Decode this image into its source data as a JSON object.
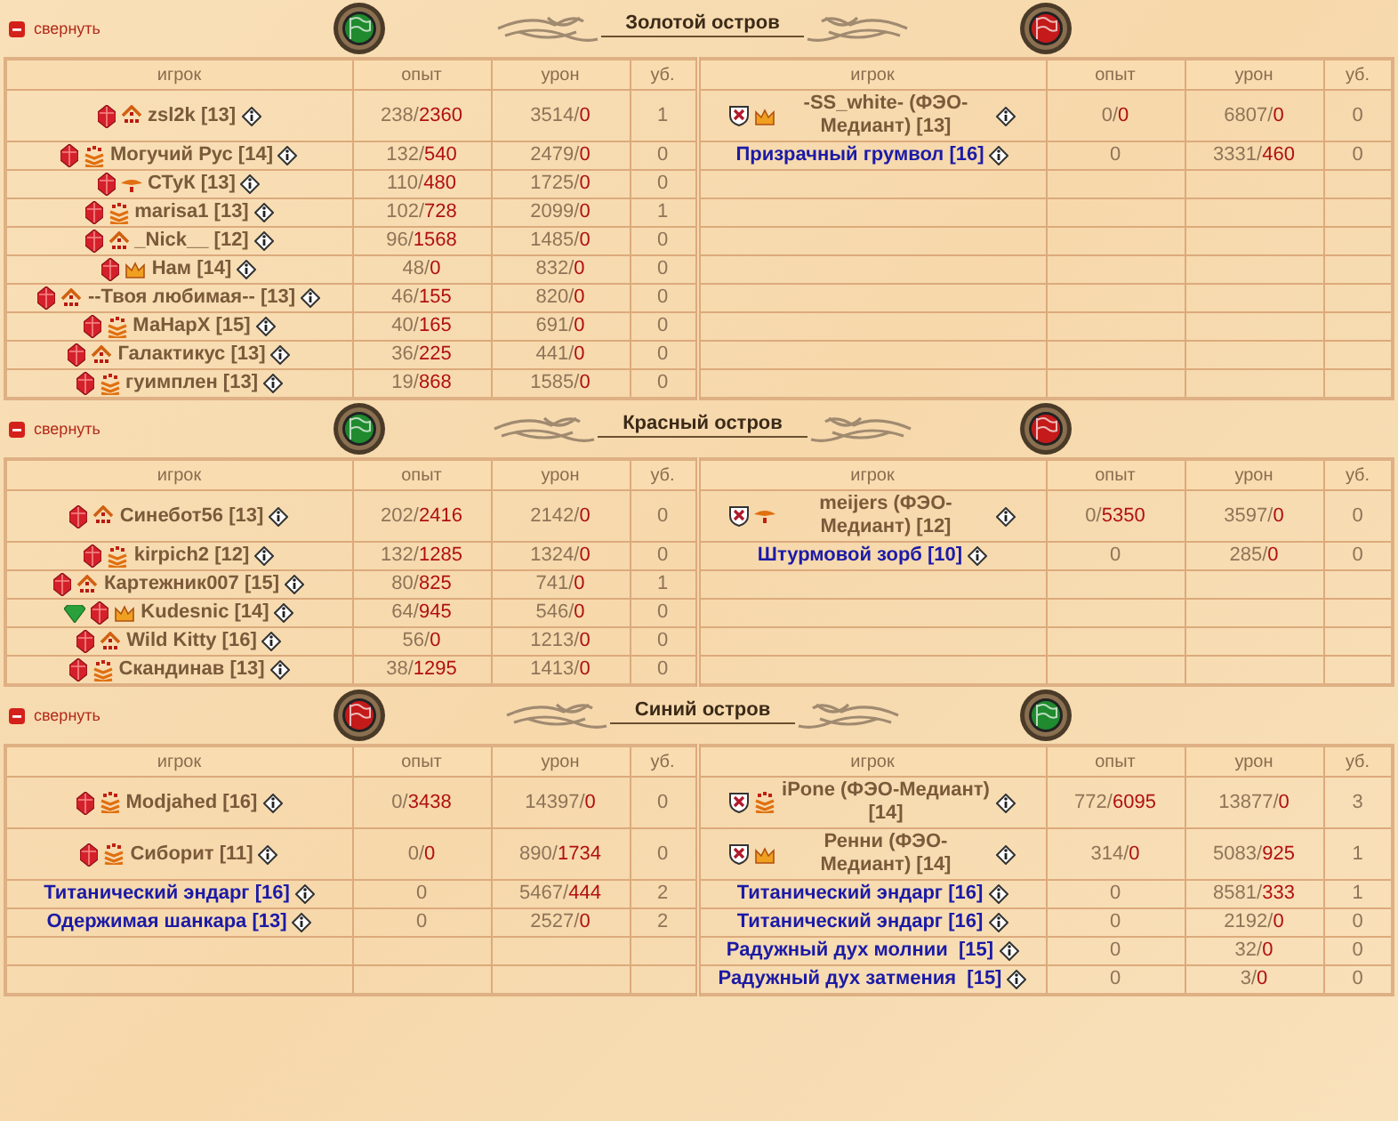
{
  "sections": [
    {
      "collapse": "свернуть",
      "title": "Золотой остров",
      "teams": [
        {
          "flag": {
            "color": "#1f8a2e"
          },
          "columns": [
            "игрок",
            "опыт",
            "урон",
            "уб."
          ],
          "players": [
            {
              "kind": "player",
              "icons": [
                {
                  "kind": "gem"
                },
                {
                  "kind": "pyramid"
                }
              ],
              "name": "zsl2k [13]",
              "exp": [
                "238/",
                "2360"
              ],
              "damage": [
                "3514/",
                "0"
              ],
              "kills": "1"
            },
            {
              "kind": "player",
              "icons": [
                {
                  "kind": "gem"
                },
                {
                  "kind": "stripes"
                }
              ],
              "name": "Могучий Рус [14]",
              "exp": [
                "132/",
                "540"
              ],
              "damage": [
                "2479/",
                "0"
              ],
              "kills": "0"
            },
            {
              "kind": "player",
              "icons": [
                {
                  "kind": "gem"
                },
                {
                  "kind": "wing"
                }
              ],
              "name": "СТуК [13]",
              "exp": [
                "110/",
                "480"
              ],
              "damage": [
                "1725/",
                "0"
              ],
              "kills": "0"
            },
            {
              "kind": "player",
              "icons": [
                {
                  "kind": "gem"
                },
                {
                  "kind": "stripes"
                }
              ],
              "name": "marisa1 [13]",
              "exp": [
                "102/",
                "728"
              ],
              "damage": [
                "2099/",
                "0"
              ],
              "kills": "1"
            },
            {
              "kind": "player",
              "icons": [
                {
                  "kind": "gem"
                },
                {
                  "kind": "pyramid"
                }
              ],
              "name": "_Nick__ [12]",
              "exp": [
                "96/",
                "1568"
              ],
              "damage": [
                "1485/",
                "0"
              ],
              "kills": "0"
            },
            {
              "kind": "player",
              "icons": [
                {
                  "kind": "gem"
                },
                {
                  "kind": "crown"
                }
              ],
              "name": "Нам [14]",
              "exp": [
                "48/",
                "0"
              ],
              "damage": [
                "832/",
                "0"
              ],
              "kills": "0"
            },
            {
              "kind": "player",
              "icons": [
                {
                  "kind": "gem"
                },
                {
                  "kind": "pyramid"
                }
              ],
              "name": "--Твоя любимая-- [13]",
              "exp": [
                "46/",
                "155"
              ],
              "damage": [
                "820/",
                "0"
              ],
              "kills": "0"
            },
            {
              "kind": "player",
              "icons": [
                {
                  "kind": "gem"
                },
                {
                  "kind": "stripes"
                }
              ],
              "name": "МаНарХ [15]",
              "exp": [
                "40/",
                "165"
              ],
              "damage": [
                "691/",
                "0"
              ],
              "kills": "0"
            },
            {
              "kind": "player",
              "icons": [
                {
                  "kind": "gem"
                },
                {
                  "kind": "pyramid"
                }
              ],
              "name": "Галактикус [13]",
              "exp": [
                "36/",
                "225"
              ],
              "damage": [
                "441/",
                "0"
              ],
              "kills": "0"
            },
            {
              "kind": "player",
              "icons": [
                {
                  "kind": "gem"
                },
                {
                  "kind": "stripes"
                }
              ],
              "name": "гуимплен [13]",
              "exp": [
                "19/",
                "868"
              ],
              "damage": [
                "1585/",
                "0"
              ],
              "kills": "0"
            }
          ]
        },
        {
          "flag": {
            "color": "#c41a1a"
          },
          "columns": [
            "игрок",
            "опыт",
            "урон",
            "уб."
          ],
          "players": [
            {
              "kind": "player",
              "icons": [
                {
                  "kind": "shield"
                },
                {
                  "kind": "crown"
                }
              ],
              "name": "-SS_white- (ФЭО-Медиант) [13]",
              "exp": [
                "0/",
                "0"
              ],
              "damage": [
                "6807/",
                "0"
              ],
              "kills": "0"
            },
            {
              "kind": "monster",
              "name": "Призрачный грумвол [16]",
              "exp": [
                "0"
              ],
              "damage": [
                "3331/",
                "460"
              ],
              "kills": "0"
            }
          ]
        }
      ]
    },
    {
      "collapse": "свернуть",
      "title": "Красный остров",
      "teams": [
        {
          "flag": {
            "color": "#1f8a2e"
          },
          "columns": [
            "игрок",
            "опыт",
            "урон",
            "уб."
          ],
          "players": [
            {
              "kind": "player",
              "icons": [
                {
                  "kind": "gem"
                },
                {
                  "kind": "pyramid"
                }
              ],
              "name": "Синебот56 [13]",
              "exp": [
                "202/",
                "2416"
              ],
              "damage": [
                "2142/",
                "0"
              ],
              "kills": "0"
            },
            {
              "kind": "player",
              "icons": [
                {
                  "kind": "gem"
                },
                {
                  "kind": "stripes"
                }
              ],
              "name": "kirpich2 [12]",
              "exp": [
                "132/",
                "1285"
              ],
              "damage": [
                "1324/",
                "0"
              ],
              "kills": "0"
            },
            {
              "kind": "player",
              "icons": [
                {
                  "kind": "gem"
                },
                {
                  "kind": "pyramid"
                }
              ],
              "name": "Картежник007 [15]",
              "exp": [
                "80/",
                "825"
              ],
              "damage": [
                "741/",
                "0"
              ],
              "kills": "1"
            },
            {
              "kind": "player",
              "icons": [
                {
                  "kind": "emerald"
                },
                {
                  "kind": "gem"
                },
                {
                  "kind": "crown"
                }
              ],
              "name": "Kudesnic [14]",
              "exp": [
                "64/",
                "945"
              ],
              "damage": [
                "546/",
                "0"
              ],
              "kills": "0"
            },
            {
              "kind": "player",
              "icons": [
                {
                  "kind": "gem"
                },
                {
                  "kind": "pyramid"
                }
              ],
              "name": "Wild Kitty [16]",
              "exp": [
                "56/",
                "0"
              ],
              "damage": [
                "1213/",
                "0"
              ],
              "kills": "0"
            },
            {
              "kind": "player",
              "icons": [
                {
                  "kind": "gem"
                },
                {
                  "kind": "stripes"
                }
              ],
              "name": "Скандинав [13]",
              "exp": [
                "38/",
                "1295"
              ],
              "damage": [
                "1413/",
                "0"
              ],
              "kills": "0"
            }
          ]
        },
        {
          "flag": {
            "color": "#c41a1a"
          },
          "columns": [
            "игрок",
            "опыт",
            "урон",
            "уб."
          ],
          "players": [
            {
              "kind": "player",
              "icons": [
                {
                  "kind": "shield"
                },
                {
                  "kind": "wing"
                }
              ],
              "name": "meijers (ФЭО-Медиант) [12]",
              "exp": [
                "0/",
                "5350"
              ],
              "damage": [
                "3597/",
                "0"
              ],
              "kills": "0"
            },
            {
              "kind": "monster",
              "name": "Штурмовой зорб [10]",
              "exp": [
                "0"
              ],
              "damage": [
                "285/",
                "0"
              ],
              "kills": "0"
            }
          ]
        }
      ]
    },
    {
      "collapse": "свернуть",
      "title": "Синий остров",
      "teams": [
        {
          "flag": {
            "color": "#c41a1a"
          },
          "columns": [
            "игрок",
            "опыт",
            "урон",
            "уб."
          ],
          "players": [
            {
              "kind": "player",
              "icons": [
                {
                  "kind": "gem"
                },
                {
                  "kind": "stripes"
                }
              ],
              "name": "Modjahed [16]",
              "exp": [
                "0/",
                "3438"
              ],
              "damage": [
                "14397/",
                "0"
              ],
              "kills": "0"
            },
            {
              "kind": "player",
              "icons": [
                {
                  "kind": "gem"
                },
                {
                  "kind": "stripes"
                }
              ],
              "name": "Сиборит [11]",
              "exp": [
                "0/",
                "0"
              ],
              "damage": [
                "890/",
                "1734"
              ],
              "kills": "0"
            },
            {
              "kind": "monster",
              "name": "Титанический эндарг [16]",
              "exp": [
                "0"
              ],
              "damage": [
                "5467/",
                "444"
              ],
              "kills": "2"
            },
            {
              "kind": "monster",
              "name": "Одержимая шанкара [13]",
              "exp": [
                "0"
              ],
              "damage": [
                "2527/",
                "0"
              ],
              "kills": "2"
            }
          ]
        },
        {
          "flag": {
            "color": "#1f8a2e"
          },
          "columns": [
            "игрок",
            "опыт",
            "урон",
            "уб."
          ],
          "players": [
            {
              "kind": "player",
              "icons": [
                {
                  "kind": "shield"
                },
                {
                  "kind": "stripes"
                }
              ],
              "name": "iPone (ФЭО-Медиант) [14]",
              "exp": [
                "772/",
                "6095"
              ],
              "damage": [
                "13877/",
                "0"
              ],
              "kills": "3"
            },
            {
              "kind": "player",
              "icons": [
                {
                  "kind": "shield"
                },
                {
                  "kind": "crown"
                }
              ],
              "name": "Ренни (ФЭО-Медиант) [14]",
              "exp": [
                "314/",
                "0"
              ],
              "damage": [
                "5083/",
                "925"
              ],
              "kills": "1"
            },
            {
              "kind": "monster",
              "name": "Титанический эндарг [16]",
              "exp": [
                "0"
              ],
              "damage": [
                "8581/",
                "333"
              ],
              "kills": "1"
            },
            {
              "kind": "monster",
              "name": "Титанический эндарг [16]",
              "exp": [
                "0"
              ],
              "damage": [
                "2192/",
                "0"
              ],
              "kills": "0"
            },
            {
              "kind": "monster",
              "name": "Радужный дух молнии  [15]",
              "exp": [
                "0"
              ],
              "damage": [
                "32/",
                "0"
              ],
              "kills": "0"
            },
            {
              "kind": "monster",
              "name": "Радужный дух затмения  [15]",
              "exp": [
                "0"
              ],
              "damage": [
                "3/",
                "0"
              ],
              "kills": "0"
            }
          ]
        }
      ]
    }
  ]
}
